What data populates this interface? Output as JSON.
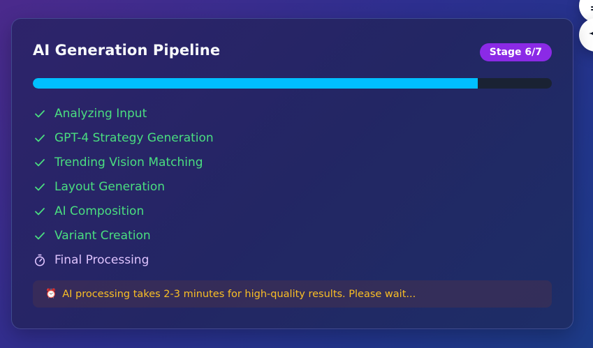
{
  "card": {
    "title": "AI Generation Pipeline",
    "stage_badge": "Stage 6/7",
    "progress": 0.857
  },
  "steps": [
    {
      "label": "Analyzing Input",
      "status": "done",
      "icon": "check-icon"
    },
    {
      "label": "GPT-4 Strategy Generation",
      "status": "done",
      "icon": "check-icon"
    },
    {
      "label": "Trending Vision Matching",
      "status": "done",
      "icon": "check-icon"
    },
    {
      "label": "Layout Generation",
      "status": "done",
      "icon": "check-icon"
    },
    {
      "label": "AI Composition",
      "status": "done",
      "icon": "check-icon"
    },
    {
      "label": "Variant Creation",
      "status": "done",
      "icon": "check-icon"
    },
    {
      "label": "Final Processing",
      "status": "current",
      "icon": "timer-icon"
    }
  ],
  "notice": {
    "icon": "alarm-clock-icon",
    "text": "AI processing takes 2-3 minutes for high-quality results. Please wait..."
  },
  "floating_buttons": [
    {
      "icon": "menu-icon"
    },
    {
      "icon": "sparkle-icon"
    }
  ],
  "colors": {
    "accent_purple": "#8b2ae6",
    "progress_blue": "#00bfff",
    "done_green": "#4ade80",
    "current_lavender": "#dfc4ff",
    "notice_amber": "#fbbf24"
  }
}
